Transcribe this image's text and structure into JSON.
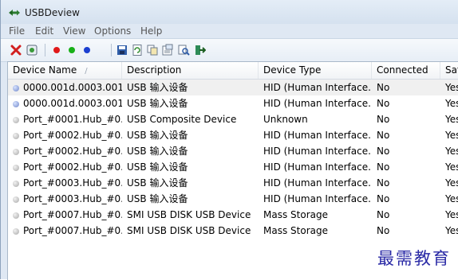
{
  "window": {
    "title": "USBDeview",
    "accent_color": "#2f7fd6"
  },
  "menubar": {
    "items": [
      "File",
      "Edit",
      "View",
      "Options",
      "Help"
    ]
  },
  "toolbar": {
    "icons": [
      "delete-icon",
      "properties-icon",
      "red-dot-icon",
      "green-dot-icon",
      "blue-dot-icon",
      "save-icon",
      "refresh-icon",
      "copy-icon",
      "html-report-icon",
      "find-icon",
      "exit-icon"
    ]
  },
  "table": {
    "columns": [
      "Device Name",
      "Description",
      "Device Type",
      "Connected",
      "Safe"
    ],
    "sort_indicator": "/",
    "rows": [
      {
        "status": "blue",
        "device_name": "0000.001d.0003.001...",
        "description": "USB 输入设备",
        "device_type": "HID (Human Interface...",
        "connected": "No",
        "safe": "Yes",
        "selected": true
      },
      {
        "status": "blue",
        "device_name": "0000.001d.0003.001...",
        "description": "USB 输入设备",
        "device_type": "HID (Human Interface...",
        "connected": "No",
        "safe": "Yes",
        "selected": false
      },
      {
        "status": "grey",
        "device_name": "Port_#0001.Hub_#0...",
        "description": "USB Composite Device",
        "device_type": "Unknown",
        "connected": "No",
        "safe": "Yes",
        "selected": false
      },
      {
        "status": "grey",
        "device_name": "Port_#0002.Hub_#0...",
        "description": "USB 输入设备",
        "device_type": "HID (Human Interface...",
        "connected": "No",
        "safe": "Yes",
        "selected": false
      },
      {
        "status": "grey",
        "device_name": "Port_#0002.Hub_#0...",
        "description": "USB 输入设备",
        "device_type": "HID (Human Interface...",
        "connected": "No",
        "safe": "Yes",
        "selected": false
      },
      {
        "status": "grey",
        "device_name": "Port_#0002.Hub_#0...",
        "description": "USB 输入设备",
        "device_type": "HID (Human Interface...",
        "connected": "No",
        "safe": "Yes",
        "selected": false
      },
      {
        "status": "grey",
        "device_name": "Port_#0003.Hub_#0...",
        "description": "USB 输入设备",
        "device_type": "HID (Human Interface...",
        "connected": "No",
        "safe": "Yes",
        "selected": false
      },
      {
        "status": "grey",
        "device_name": "Port_#0003.Hub_#0...",
        "description": "USB 输入设备",
        "device_type": "HID (Human Interface...",
        "connected": "No",
        "safe": "Yes",
        "selected": false
      },
      {
        "status": "grey",
        "device_name": "Port_#0007.Hub_#0...",
        "description": "SMI USB DISK USB Device",
        "device_type": "Mass Storage",
        "connected": "No",
        "safe": "Yes",
        "selected": false
      },
      {
        "status": "grey",
        "device_name": "Port_#0007.Hub_#0...",
        "description": "SMI USB DISK USB Device",
        "device_type": "Mass Storage",
        "connected": "No",
        "safe": "Yes",
        "selected": false
      }
    ]
  },
  "watermark": {
    "text": "最需教育",
    "color": "#2a2aa6"
  }
}
